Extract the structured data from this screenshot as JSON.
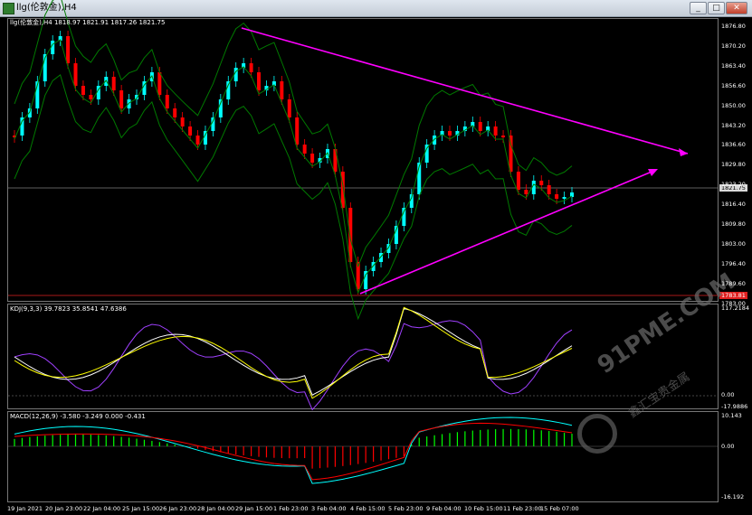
{
  "window": {
    "title": "llg(伦敦金),H4",
    "minimize_label": "_",
    "maximize_label": "□",
    "close_label": "✕"
  },
  "main_panel": {
    "label": "llg(伦敦金),H4  1818.97 1821.91 1817.26 1821.75",
    "y_ticks": [
      "1876.80",
      "1870.20",
      "1863.40",
      "1856.60",
      "1850.00",
      "1843.20",
      "1836.60",
      "1829.80",
      "1823.20",
      "1816.40",
      "1809.80",
      "1803.00",
      "1796.40",
      "1789.60",
      "1783.00"
    ],
    "y_range": [
      1783.0,
      1876.8
    ],
    "current_price": "1821.75",
    "low_line_price": "1783.81",
    "colors": {
      "bull": "#00ffff",
      "bear": "#ff0000",
      "band": "#007a00",
      "trend": "#ff00ff"
    }
  },
  "kdj_panel": {
    "label": "KDJ(9,3,3) 39.7823 35.8541 47.6386",
    "y_ticks": [
      "117.2184",
      "0.00",
      "-17.9886"
    ],
    "colors": {
      "k": "#ffffff",
      "d": "#ffff00",
      "j": "#a040ff"
    }
  },
  "macd_panel": {
    "label": "MACD(12,26,9) -3.580 -3.249 0.000 -0.431",
    "y_ticks": [
      "10.143",
      "0.00",
      "-16.192"
    ],
    "colors": {
      "macd": "#00ffff",
      "signal": "#ff0000",
      "hist_pos": "#00ff00",
      "hist_neg": "#ff0000"
    }
  },
  "x_axis": {
    "labels": [
      "19 Jan 2021",
      "20 Jan 23:00",
      "22 Jan 04:00",
      "25 Jan 15:00",
      "26 Jan 23:00",
      "28 Jan 04:00",
      "29 Jan 15:00",
      "1 Feb 23:00",
      "3 Feb 04:00",
      "4 Feb 15:00",
      "5 Feb 23:00",
      "9 Feb 04:00",
      "10 Feb 15:00",
      "11 Feb 23:00",
      "15 Feb 07:00"
    ]
  },
  "watermark": {
    "site": "91PME.COM",
    "brand": "鑫汇宝贵金属"
  }
}
